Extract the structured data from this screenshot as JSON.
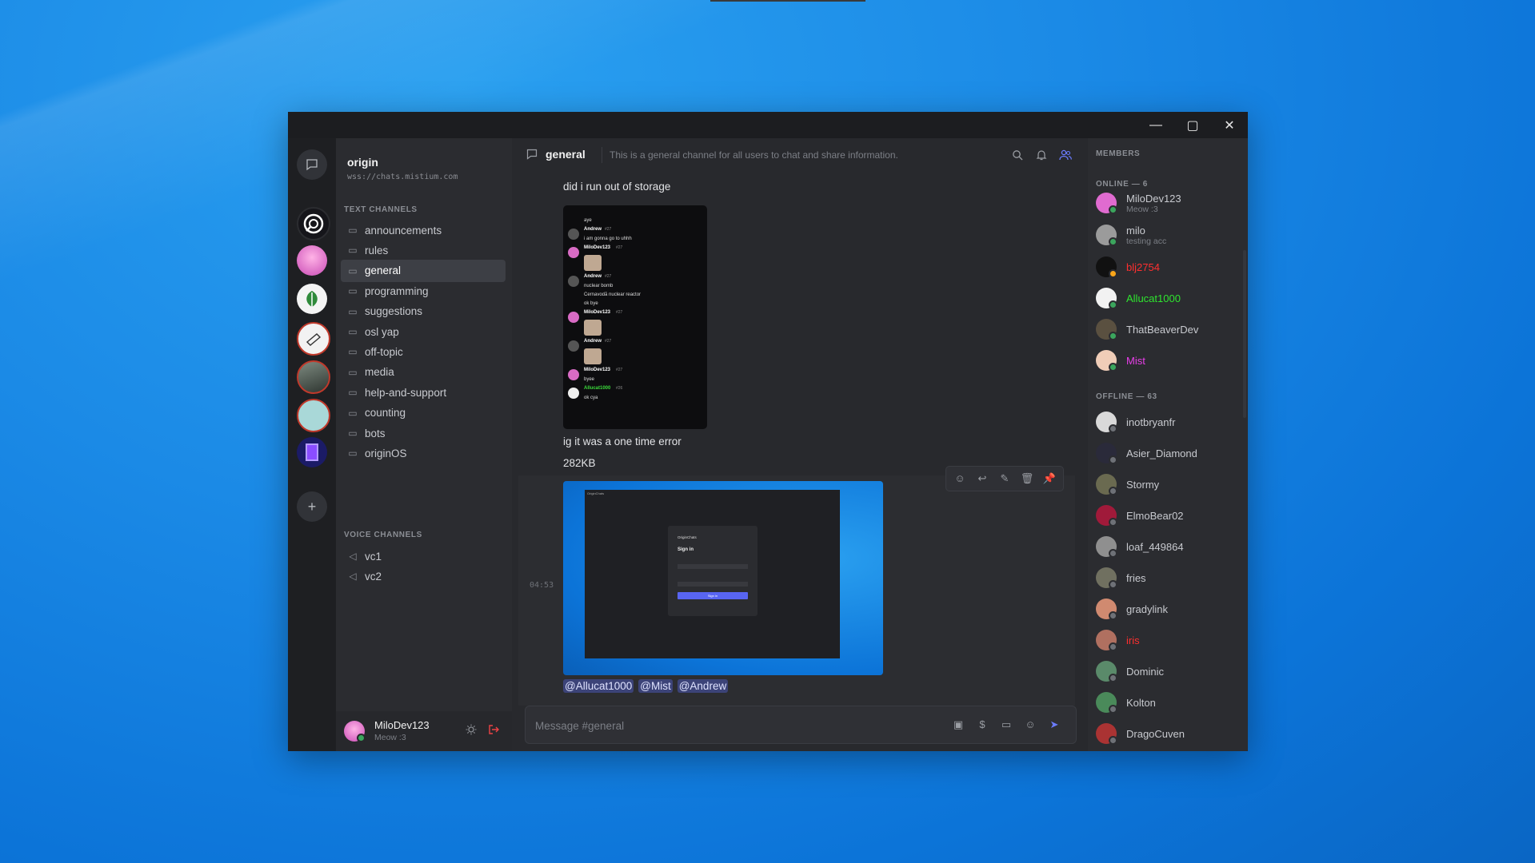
{
  "window": {
    "controls": {
      "minimize": "—",
      "maximize": "▢",
      "close": "✕"
    }
  },
  "server_rail": {
    "add_label": "+"
  },
  "server": {
    "name": "origin",
    "url": "wss://chats.mistium.com"
  },
  "categories": {
    "text": "TEXT CHANNELS",
    "voice": "VOICE CHANNELS"
  },
  "text_channels": [
    {
      "label": "announcements"
    },
    {
      "label": "rules"
    },
    {
      "label": "general",
      "active": true
    },
    {
      "label": "programming"
    },
    {
      "label": "suggestions"
    },
    {
      "label": "osl yap"
    },
    {
      "label": "off-topic"
    },
    {
      "label": "media"
    },
    {
      "label": "help-and-support"
    },
    {
      "label": "counting"
    },
    {
      "label": "bots"
    },
    {
      "label": "originOS"
    }
  ],
  "voice_channels": [
    {
      "label": "vc1"
    },
    {
      "label": "vc2"
    }
  ],
  "current_user": {
    "name": "MiloDev123",
    "status": "Meow :3"
  },
  "chat": {
    "channel": "general",
    "topic": "This is a general channel for all users to chat and share information.",
    "messages": [
      {
        "text": "did i run out of storage"
      },
      {
        "text": "ig it was a one time error"
      },
      {
        "text": "282KB"
      }
    ],
    "timestamp": "04:53",
    "mentions": [
      "@Allucat1000",
      "@Mist",
      "@Andrew"
    ],
    "input_placeholder": "Message #general"
  },
  "preview1": {
    "lines": [
      {
        "kind": "text",
        "t": "aye"
      },
      {
        "kind": "user",
        "name": "Andrew",
        "tag": "#27",
        "color": "#ffffff"
      },
      {
        "kind": "text",
        "t": "i am gonna go to uhhh"
      },
      {
        "kind": "user",
        "name": "MiloDev123",
        "tag": "#27",
        "color": "#ffffff"
      },
      {
        "kind": "img"
      },
      {
        "kind": "user",
        "name": "Andrew",
        "tag": "#27",
        "color": "#ffffff"
      },
      {
        "kind": "text",
        "t": "nuclear bomb"
      },
      {
        "kind": "text",
        "t": "Cernavodă nuclear reactor"
      },
      {
        "kind": "text",
        "t": "ok bye"
      },
      {
        "kind": "user",
        "name": "MiloDev123",
        "tag": "#27",
        "color": "#ffffff"
      },
      {
        "kind": "img"
      },
      {
        "kind": "user",
        "name": "Andrew",
        "tag": "#27",
        "color": "#ffffff"
      },
      {
        "kind": "img"
      },
      {
        "kind": "user",
        "name": "MiloDev123",
        "tag": "#27",
        "color": "#ffffff"
      },
      {
        "kind": "text",
        "t": "byee"
      },
      {
        "kind": "user",
        "name": "Allucat1000",
        "tag": "#26",
        "color": "#3bdc3b"
      },
      {
        "kind": "text",
        "t": "ok cya"
      }
    ]
  },
  "preview2": {
    "title": "OriginChats",
    "heading": "Sign in",
    "button": "Sign in"
  },
  "members": {
    "title": "MEMBERS",
    "online_label": "ONLINE — 6",
    "offline_label": "OFFLINE — 63",
    "online": [
      {
        "name": "MiloDev123",
        "sub": "Meow :3",
        "color": "#c8cacf",
        "av": "#e06bd0",
        "status": "#3ba55d"
      },
      {
        "name": "milo",
        "sub": "testing acc",
        "color": "#c8cacf",
        "av": "#9b9b9b",
        "status": "#3ba55d"
      },
      {
        "name": "blj2754",
        "sub": "",
        "color": "#ff2f2f",
        "av": "#111111",
        "status": "#faa61a"
      },
      {
        "name": "Allucat1000",
        "sub": "",
        "color": "#2ee52e",
        "av": "#f2f2f2",
        "status": "#3ba55d"
      },
      {
        "name": "ThatBeaverDev",
        "sub": "",
        "color": "#c8cacf",
        "av": "#5a5040",
        "status": "#3ba55d"
      },
      {
        "name": "Mist",
        "sub": "",
        "color": "#e83ee8",
        "av": "#f0cdb8",
        "status": "#3ba55d"
      }
    ],
    "offline": [
      {
        "name": "inotbryanfr",
        "color": "#c8cacf",
        "av": "#d9d9d9"
      },
      {
        "name": "Asier_Diamond",
        "color": "#c8cacf",
        "av": "#2a2a3a"
      },
      {
        "name": "Stormy",
        "color": "#c8cacf",
        "av": "#6a6a50"
      },
      {
        "name": "ElmoBear02",
        "color": "#c8cacf",
        "av": "#a01a3a"
      },
      {
        "name": "loaf_449864",
        "color": "#c8cacf",
        "av": "#8f8f8f"
      },
      {
        "name": "fries",
        "color": "#c8cacf",
        "av": "#707060"
      },
      {
        "name": "gradylink",
        "color": "#c8cacf",
        "av": "#d08a70"
      },
      {
        "name": "iris",
        "color": "#ff2f2f",
        "av": "#b07060"
      },
      {
        "name": "Dominic",
        "color": "#c8cacf",
        "av": "#5a8a6a"
      },
      {
        "name": "Kolton",
        "color": "#c8cacf",
        "av": "#4a8a5a"
      },
      {
        "name": "DragoCuven",
        "color": "#c8cacf",
        "av": "#aa3333"
      }
    ]
  },
  "colors": {
    "accent": "#5865f2",
    "mention_bg": "#3c4378",
    "online": "#3ba55d",
    "logout": "#ed4245"
  }
}
